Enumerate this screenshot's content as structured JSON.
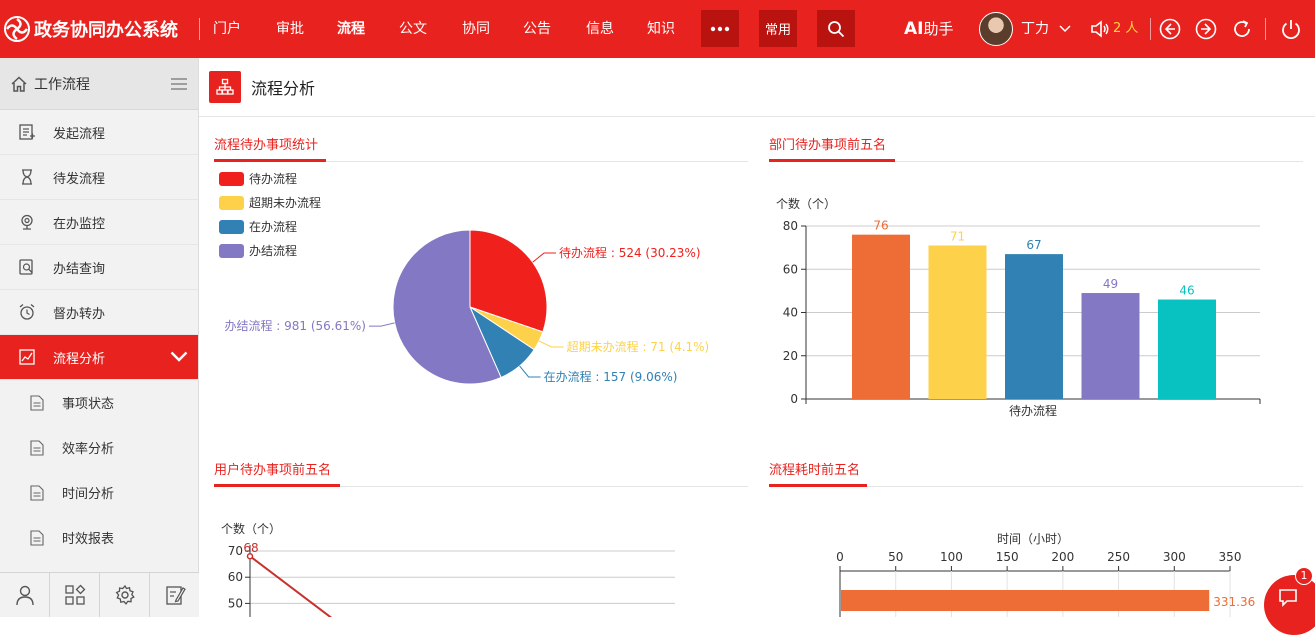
{
  "app": {
    "title": "政务协同办公系统"
  },
  "nav": {
    "items": [
      "门户",
      "审批",
      "流程",
      "公文",
      "协同",
      "公告",
      "信息",
      "知识"
    ],
    "active": "流程",
    "more_icon": "more-dots-icon",
    "common_label": "常用",
    "search_icon": "search-icon"
  },
  "header": {
    "ai_prefix": "AI",
    "ai_label": "助手",
    "user_name": "丁力",
    "online_count": "2 人"
  },
  "sidebar": {
    "title": "工作流程",
    "items": [
      {
        "label": "发起流程",
        "icon": "start-flow-icon"
      },
      {
        "label": "待发流程",
        "icon": "hourglass-icon"
      },
      {
        "label": "在办监控",
        "icon": "monitor-icon"
      },
      {
        "label": "办结查询",
        "icon": "search-doc-icon"
      },
      {
        "label": "督办转办",
        "icon": "alarm-clock-icon"
      },
      {
        "label": "流程分析",
        "icon": "chart-icon"
      }
    ],
    "subitems": [
      "事项状态",
      "效率分析",
      "时间分析",
      "时效报表"
    ]
  },
  "page": {
    "title": "流程分析"
  },
  "panels": {
    "p1": {
      "title": "流程待办事项统计"
    },
    "p2": {
      "title": "部门待办事项前五名"
    },
    "p3": {
      "title": "用户待办事项前五名"
    },
    "p4": {
      "title": "流程耗时前五名"
    }
  },
  "fab": {
    "badge": "1"
  },
  "chart_data": [
    {
      "type": "pie",
      "title": "流程待办事项统计",
      "series": [
        {
          "name": "待办流程",
          "value": 524,
          "label": "待办流程 : 524 (30.23%)",
          "color": "#f0201d"
        },
        {
          "name": "超期未办流程",
          "value": 71,
          "label": "超期未办流程 : 71 (4.1%)",
          "color": "#fdd24a"
        },
        {
          "name": "在办流程",
          "value": 157,
          "label": "在办流程 : 157 (9.06%)",
          "color": "#3281b4"
        },
        {
          "name": "办结流程",
          "value": 981,
          "label": "办结流程 : 981 (56.61%)",
          "color": "#8378c4"
        }
      ],
      "legend": "top-left"
    },
    {
      "type": "bar",
      "title": "部门待办事项前五名",
      "ylabel": "个数（个）",
      "categories": [
        "待办流程"
      ],
      "values": [
        76,
        71,
        67,
        49,
        46
      ],
      "colors": [
        "#ee6c35",
        "#fdd24a",
        "#3281b4",
        "#8378c4",
        "#08c1c1"
      ],
      "ylim": [
        0,
        80
      ],
      "yticks": [
        0,
        20,
        40,
        60,
        80
      ],
      "grid": true
    },
    {
      "type": "line",
      "title": "用户待办事项前五名",
      "ylabel": "个数（个）",
      "values": [
        68
      ],
      "yticks": [
        50,
        60,
        70
      ],
      "color": "#c9302c",
      "grid": true
    },
    {
      "type": "bar",
      "orientation": "horizontal",
      "title": "流程耗时前五名",
      "xlabel": "时间（小时）",
      "values": [
        331.36
      ],
      "xticks": [
        0,
        50,
        100,
        150,
        200,
        250,
        300,
        350
      ],
      "xlim": [
        0,
        350
      ],
      "color": "#ee6c35"
    }
  ]
}
